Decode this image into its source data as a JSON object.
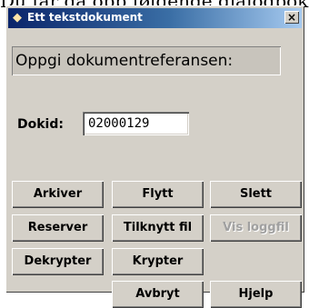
{
  "background_text": "Du får da opp følgende dialogboks",
  "window": {
    "title": "Ett tekstdokument",
    "close_label": "×"
  },
  "heading": "Oppgi dokumentreferansen:",
  "dokid": {
    "label": "Dokid:",
    "value": "02000129"
  },
  "buttons": {
    "arkiver": "Arkiver",
    "flytt": "Flytt",
    "slett": "Slett",
    "reserver": "Reserver",
    "tilknytt_fil": "Tilknytt fil",
    "vis_loggfil": "Vis loggfil",
    "dekrypter": "Dekrypter",
    "krypter": "Krypter",
    "avbryt": "Avbryt",
    "hjelp": "Hjelp"
  },
  "colors": {
    "titlebar_start": "#0a246a",
    "titlebar_end": "#a6caf0",
    "dialog_face": "#d4d0c8"
  }
}
